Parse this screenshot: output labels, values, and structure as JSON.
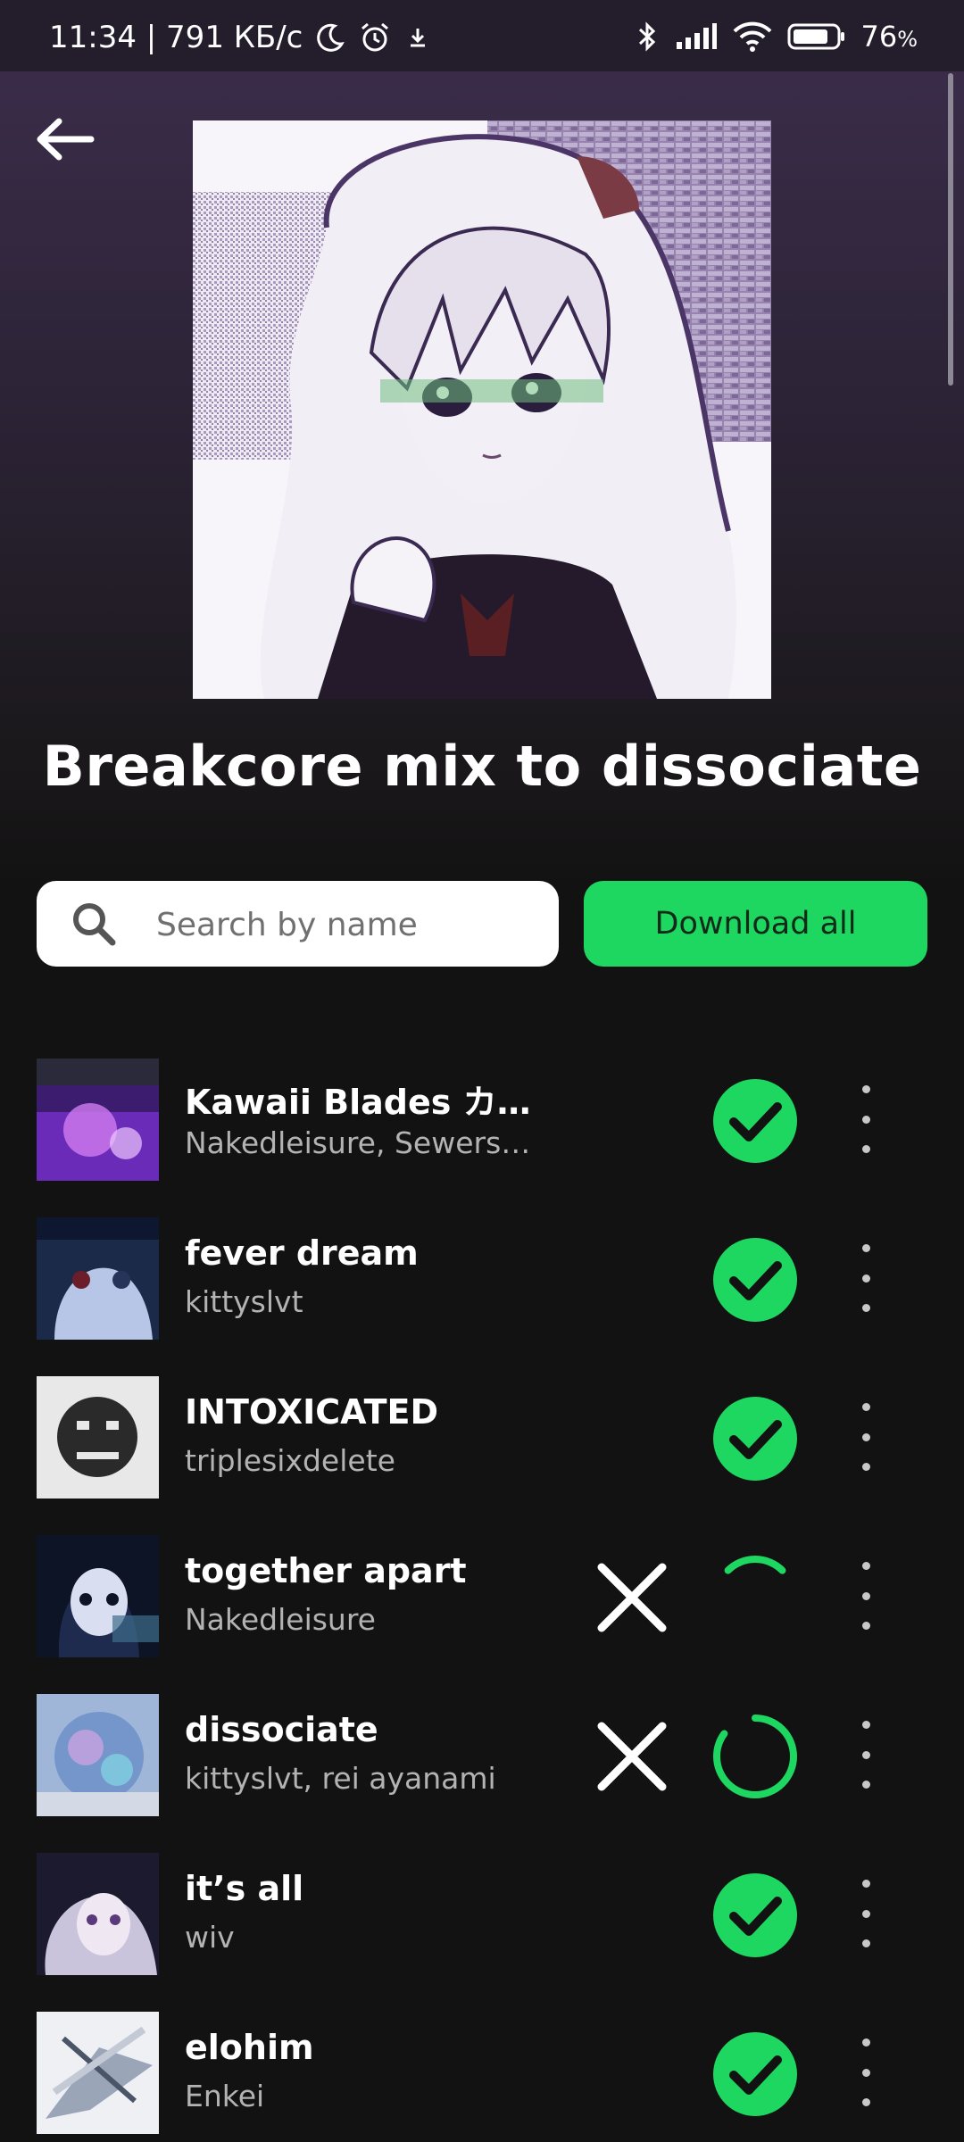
{
  "status_bar": {
    "time": "11:34 | 791 КБ/с",
    "battery": "76",
    "battery_unit": "%"
  },
  "header": {
    "back_icon": "arrow-left-icon"
  },
  "playlist": {
    "title": "Breakcore mix to dissociate"
  },
  "search": {
    "placeholder": "Search by name",
    "value": ""
  },
  "actions": {
    "download_all_label": "Download all"
  },
  "colors": {
    "accent": "#1ed760",
    "background": "#121212",
    "header_gradient_top": "#3d2e4d"
  },
  "tracks": [
    {
      "title": "Kawaii Blades カワ…",
      "artist": "Nakedleisure, Sewers…",
      "status": "downloaded"
    },
    {
      "title": "fever dream",
      "artist": "kittyslvt",
      "status": "downloaded"
    },
    {
      "title": "INTOXICATED",
      "artist": "triplesixdelete",
      "status": "downloaded"
    },
    {
      "title": "together apart",
      "artist": "Nakedleisure",
      "status": "downloading",
      "progress": 0.25
    },
    {
      "title": "dissociate",
      "artist": "kittyslvt, rei ayanami",
      "status": "downloading",
      "progress": 0.85
    },
    {
      "title": "it’s all",
      "artist": "wiv",
      "status": "downloaded"
    },
    {
      "title": "elohim",
      "artist": "Enkei",
      "status": "downloaded"
    }
  ]
}
